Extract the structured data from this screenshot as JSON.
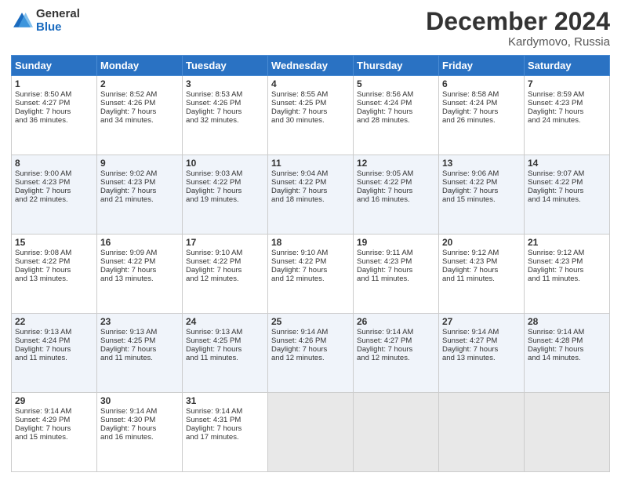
{
  "header": {
    "logo_general": "General",
    "logo_blue": "Blue",
    "month_title": "December 2024",
    "location": "Kardymovo, Russia"
  },
  "days_of_week": [
    "Sunday",
    "Monday",
    "Tuesday",
    "Wednesday",
    "Thursday",
    "Friday",
    "Saturday"
  ],
  "weeks": [
    [
      {
        "day": "1",
        "lines": [
          "Sunrise: 8:50 AM",
          "Sunset: 4:27 PM",
          "Daylight: 7 hours",
          "and 36 minutes."
        ]
      },
      {
        "day": "2",
        "lines": [
          "Sunrise: 8:52 AM",
          "Sunset: 4:26 PM",
          "Daylight: 7 hours",
          "and 34 minutes."
        ]
      },
      {
        "day": "3",
        "lines": [
          "Sunrise: 8:53 AM",
          "Sunset: 4:26 PM",
          "Daylight: 7 hours",
          "and 32 minutes."
        ]
      },
      {
        "day": "4",
        "lines": [
          "Sunrise: 8:55 AM",
          "Sunset: 4:25 PM",
          "Daylight: 7 hours",
          "and 30 minutes."
        ]
      },
      {
        "day": "5",
        "lines": [
          "Sunrise: 8:56 AM",
          "Sunset: 4:24 PM",
          "Daylight: 7 hours",
          "and 28 minutes."
        ]
      },
      {
        "day": "6",
        "lines": [
          "Sunrise: 8:58 AM",
          "Sunset: 4:24 PM",
          "Daylight: 7 hours",
          "and 26 minutes."
        ]
      },
      {
        "day": "7",
        "lines": [
          "Sunrise: 8:59 AM",
          "Sunset: 4:23 PM",
          "Daylight: 7 hours",
          "and 24 minutes."
        ]
      }
    ],
    [
      {
        "day": "8",
        "lines": [
          "Sunrise: 9:00 AM",
          "Sunset: 4:23 PM",
          "Daylight: 7 hours",
          "and 22 minutes."
        ]
      },
      {
        "day": "9",
        "lines": [
          "Sunrise: 9:02 AM",
          "Sunset: 4:23 PM",
          "Daylight: 7 hours",
          "and 21 minutes."
        ]
      },
      {
        "day": "10",
        "lines": [
          "Sunrise: 9:03 AM",
          "Sunset: 4:22 PM",
          "Daylight: 7 hours",
          "and 19 minutes."
        ]
      },
      {
        "day": "11",
        "lines": [
          "Sunrise: 9:04 AM",
          "Sunset: 4:22 PM",
          "Daylight: 7 hours",
          "and 18 minutes."
        ]
      },
      {
        "day": "12",
        "lines": [
          "Sunrise: 9:05 AM",
          "Sunset: 4:22 PM",
          "Daylight: 7 hours",
          "and 16 minutes."
        ]
      },
      {
        "day": "13",
        "lines": [
          "Sunrise: 9:06 AM",
          "Sunset: 4:22 PM",
          "Daylight: 7 hours",
          "and 15 minutes."
        ]
      },
      {
        "day": "14",
        "lines": [
          "Sunrise: 9:07 AM",
          "Sunset: 4:22 PM",
          "Daylight: 7 hours",
          "and 14 minutes."
        ]
      }
    ],
    [
      {
        "day": "15",
        "lines": [
          "Sunrise: 9:08 AM",
          "Sunset: 4:22 PM",
          "Daylight: 7 hours",
          "and 13 minutes."
        ]
      },
      {
        "day": "16",
        "lines": [
          "Sunrise: 9:09 AM",
          "Sunset: 4:22 PM",
          "Daylight: 7 hours",
          "and 13 minutes."
        ]
      },
      {
        "day": "17",
        "lines": [
          "Sunrise: 9:10 AM",
          "Sunset: 4:22 PM",
          "Daylight: 7 hours",
          "and 12 minutes."
        ]
      },
      {
        "day": "18",
        "lines": [
          "Sunrise: 9:10 AM",
          "Sunset: 4:22 PM",
          "Daylight: 7 hours",
          "and 12 minutes."
        ]
      },
      {
        "day": "19",
        "lines": [
          "Sunrise: 9:11 AM",
          "Sunset: 4:23 PM",
          "Daylight: 7 hours",
          "and 11 minutes."
        ]
      },
      {
        "day": "20",
        "lines": [
          "Sunrise: 9:12 AM",
          "Sunset: 4:23 PM",
          "Daylight: 7 hours",
          "and 11 minutes."
        ]
      },
      {
        "day": "21",
        "lines": [
          "Sunrise: 9:12 AM",
          "Sunset: 4:23 PM",
          "Daylight: 7 hours",
          "and 11 minutes."
        ]
      }
    ],
    [
      {
        "day": "22",
        "lines": [
          "Sunrise: 9:13 AM",
          "Sunset: 4:24 PM",
          "Daylight: 7 hours",
          "and 11 minutes."
        ]
      },
      {
        "day": "23",
        "lines": [
          "Sunrise: 9:13 AM",
          "Sunset: 4:25 PM",
          "Daylight: 7 hours",
          "and 11 minutes."
        ]
      },
      {
        "day": "24",
        "lines": [
          "Sunrise: 9:13 AM",
          "Sunset: 4:25 PM",
          "Daylight: 7 hours",
          "and 11 minutes."
        ]
      },
      {
        "day": "25",
        "lines": [
          "Sunrise: 9:14 AM",
          "Sunset: 4:26 PM",
          "Daylight: 7 hours",
          "and 12 minutes."
        ]
      },
      {
        "day": "26",
        "lines": [
          "Sunrise: 9:14 AM",
          "Sunset: 4:27 PM",
          "Daylight: 7 hours",
          "and 12 minutes."
        ]
      },
      {
        "day": "27",
        "lines": [
          "Sunrise: 9:14 AM",
          "Sunset: 4:27 PM",
          "Daylight: 7 hours",
          "and 13 minutes."
        ]
      },
      {
        "day": "28",
        "lines": [
          "Sunrise: 9:14 AM",
          "Sunset: 4:28 PM",
          "Daylight: 7 hours",
          "and 14 minutes."
        ]
      }
    ],
    [
      {
        "day": "29",
        "lines": [
          "Sunrise: 9:14 AM",
          "Sunset: 4:29 PM",
          "Daylight: 7 hours",
          "and 15 minutes."
        ]
      },
      {
        "day": "30",
        "lines": [
          "Sunrise: 9:14 AM",
          "Sunset: 4:30 PM",
          "Daylight: 7 hours",
          "and 16 minutes."
        ]
      },
      {
        "day": "31",
        "lines": [
          "Sunrise: 9:14 AM",
          "Sunset: 4:31 PM",
          "Daylight: 7 hours",
          "and 17 minutes."
        ]
      },
      {
        "day": "",
        "lines": []
      },
      {
        "day": "",
        "lines": []
      },
      {
        "day": "",
        "lines": []
      },
      {
        "day": "",
        "lines": []
      }
    ]
  ]
}
